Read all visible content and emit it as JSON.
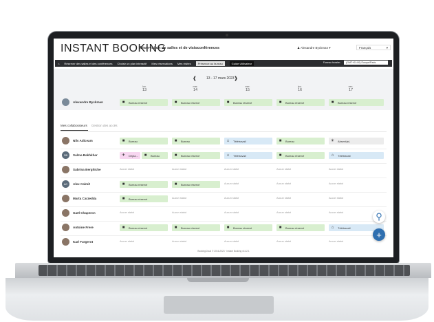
{
  "header": {
    "logo": "INSTANT BOOKING",
    "subtitle": "Réservation de salles et de visioconférences",
    "user": "Alexandre Byckman",
    "language": "Français"
  },
  "nav": {
    "items": [
      "Réserver des salles et des conférences",
      "Choisir un plan interactif",
      "Mes réservations",
      "Mes visites",
      "Présence au bureau",
      "Guide Utilisateur"
    ],
    "active": "Présence au bureau",
    "timezone_label": "Fuseau horaire :",
    "timezone_value": "(GMT+01:00) Europe/Paris"
  },
  "week": {
    "range": "13 - 17 mars 2023",
    "days": [
      {
        "wd": "lun.",
        "dn": "13"
      },
      {
        "wd": "mar.",
        "dn": "14"
      },
      {
        "wd": "mer.",
        "dn": "15"
      },
      {
        "wd": "jeu.",
        "dn": "16"
      },
      {
        "wd": "ven.",
        "dn": "17"
      }
    ]
  },
  "me": {
    "name": "Alexandre Byckman",
    "statuses": [
      "Bureau réservé",
      "Bureau réservé",
      "Bureau réservé",
      "Bureau réservé",
      "Bureau réservé"
    ]
  },
  "tabs": {
    "first": "Mes collaborateurs",
    "second": "Gestion des accès"
  },
  "status_colors": {
    "office": "#d8efcf",
    "remote": "#d8e9f6",
    "absent": "#ececec",
    "travel": "#f7d6f0"
  },
  "people": [
    {
      "initials": "",
      "name": "Nils Adiceam",
      "cells": [
        [
          "Bureau",
          "office"
        ],
        [
          "Bureau",
          "office"
        ],
        [
          "Télétravail",
          "remote"
        ],
        [
          "Bureau",
          "office"
        ],
        [
          "Absent(e)",
          "absent"
        ]
      ]
    },
    {
      "initials": "SB",
      "name": "Salma Bakhkhar",
      "cells": [
        [
          "Dépla...",
          "travel",
          "Bureau"
        ],
        [
          "Bureau réservé",
          "office"
        ],
        [
          "Télétravail",
          "remote"
        ],
        [
          "Bureau réservé",
          "office"
        ],
        [
          "Télétravail",
          "remote"
        ]
      ]
    },
    {
      "initials": "",
      "name": "Sabrina Berghiche",
      "cells": [
        [
          "Aucun statut",
          "none"
        ],
        [
          "Aucun statut",
          "none"
        ],
        [
          "Aucun statut",
          "none"
        ],
        [
          "Aucun statut",
          "none"
        ],
        [
          "Aucun statut",
          "none"
        ]
      ]
    },
    {
      "initials": "AC",
      "name": "Alex Calmit",
      "cells": [
        [
          "Bureau réservé",
          "office"
        ],
        [
          "Bureau réservé",
          "office"
        ],
        [
          "Aucun statut",
          "none"
        ],
        [
          "Aucun statut",
          "none"
        ],
        [
          "Aucun statut",
          "none"
        ]
      ]
    },
    {
      "initials": "",
      "name": "Marta Carzedda",
      "cells": [
        [
          "Bureau réservé",
          "office"
        ],
        [
          "Aucun statut",
          "none"
        ],
        [
          "Aucun statut",
          "none"
        ],
        [
          "Aucun statut",
          "none"
        ],
        [
          "Aucun statut",
          "none"
        ]
      ]
    },
    {
      "initials": "",
      "name": "Gaël Chaperon",
      "cells": [
        [
          "Aucun statut",
          "none"
        ],
        [
          "Aucun statut",
          "none"
        ],
        [
          "Aucun statut",
          "none"
        ],
        [
          "Aucun statut",
          "none"
        ],
        [
          "Aucun statut",
          "none"
        ]
      ]
    },
    {
      "initials": "",
      "name": "Antoine Frere",
      "cells": [
        [
          "Bureau réservé",
          "office"
        ],
        [
          "Bureau réservé",
          "office"
        ],
        [
          "Bureau réservé",
          "office"
        ],
        [
          "Bureau réservé",
          "office"
        ],
        [
          "Télétravail",
          "remote"
        ]
      ]
    },
    {
      "initials": "",
      "name": "Karl Furgerot",
      "cells": [
        [
          "Aucun statut",
          "none"
        ],
        [
          "Aucun statut",
          "none"
        ],
        [
          "Aucun statut",
          "none"
        ],
        [
          "Aucun statut",
          "none"
        ],
        [
          "Aucun statut",
          "none"
        ]
      ]
    }
  ],
  "footer": "BookingCloud © 2016-2023 · Instant Booking v4.42.1",
  "fab": {
    "search": "search-icon",
    "add": "plus-icon"
  }
}
